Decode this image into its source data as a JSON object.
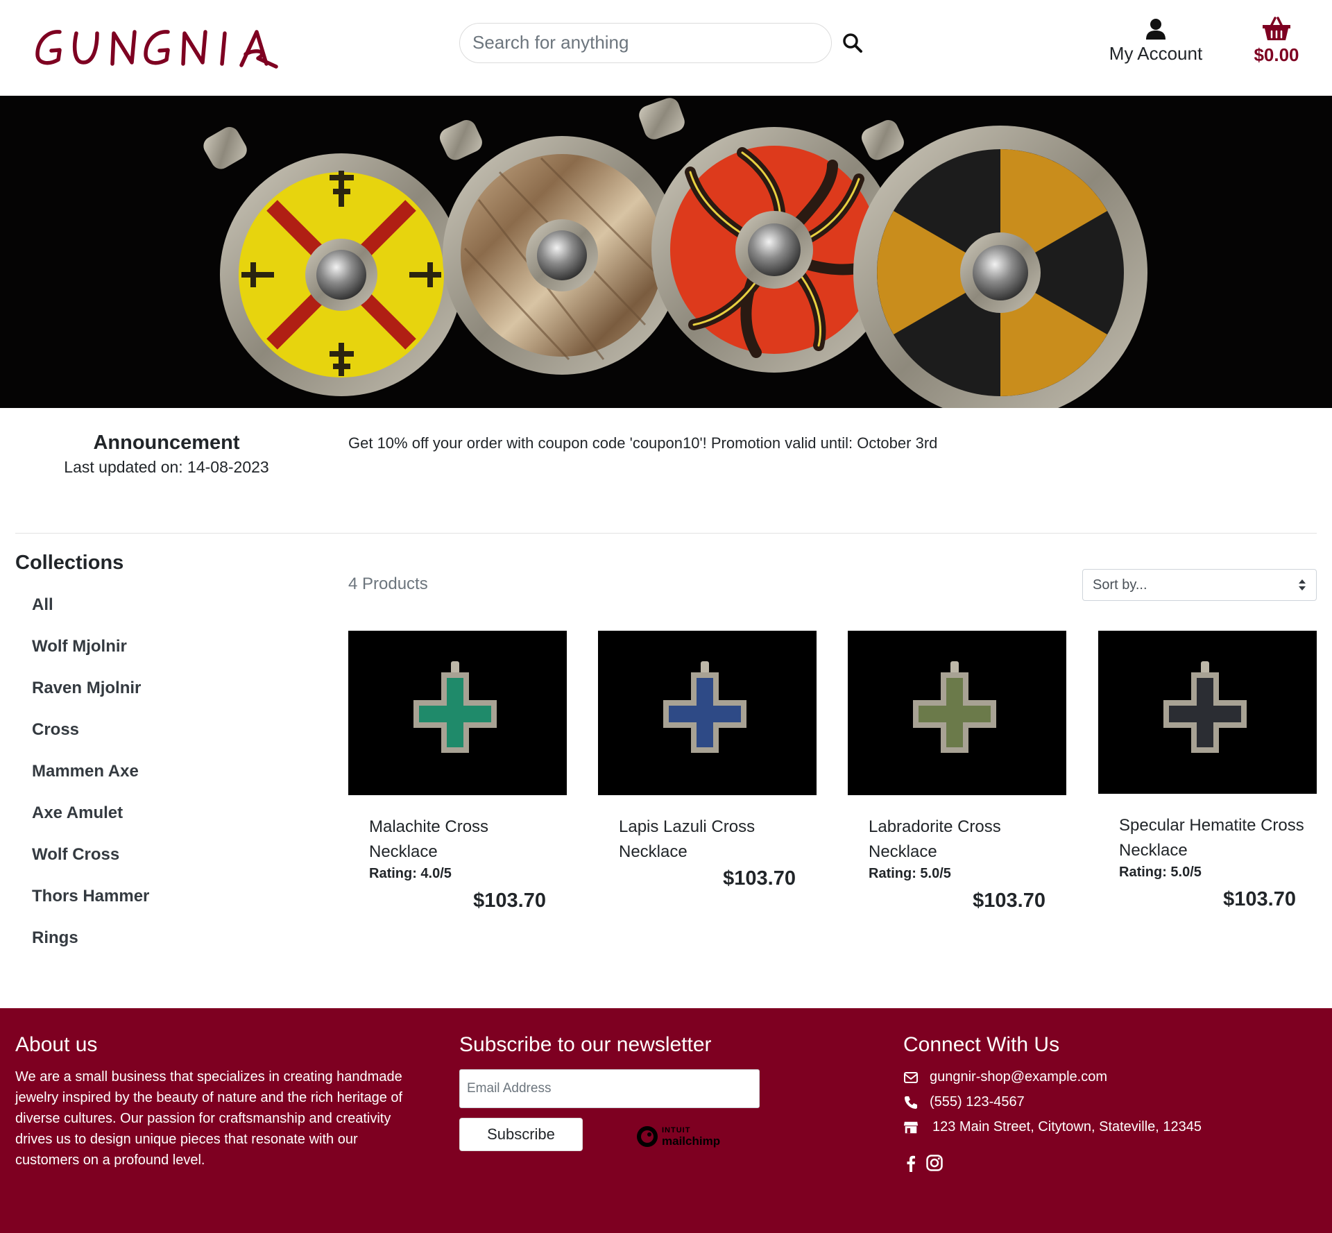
{
  "brand": {
    "logo_text": "GUNGNIR",
    "accent_color": "#7e0021"
  },
  "search": {
    "placeholder": "Search for anything"
  },
  "header": {
    "account_label": "My Account",
    "cart_total": "$0.00"
  },
  "announcement": {
    "title": "Announcement",
    "updated": "Last updated on: 14-08-2023",
    "message": "Get 10% off your order with coupon code 'coupon10'! Promotion valid until: October 3rd"
  },
  "sidebar": {
    "title": "Collections",
    "items": [
      "All",
      "Wolf Mjolnir",
      "Raven Mjolnir",
      "Cross",
      "Mammen Axe",
      "Axe Amulet",
      "Wolf Cross",
      "Thors Hammer",
      "Rings"
    ]
  },
  "products_header": {
    "count": "4 Products",
    "sort_placeholder": "Sort by..."
  },
  "products": [
    {
      "name": "Malachite Cross Necklace",
      "rating": "Rating: 4.0/5",
      "price": "$103.70",
      "stone_color": "#1f8a6a"
    },
    {
      "name": "Lapis Lazuli Cross Necklace",
      "rating": "",
      "price": "$103.70",
      "stone_color": "#2e4a86"
    },
    {
      "name": "Labradorite Cross Necklace",
      "rating": "Rating: 5.0/5",
      "price": "$103.70",
      "stone_color": "#6b7a4a"
    },
    {
      "name": "Specular Hematite Cross Necklace",
      "rating": "Rating: 5.0/5",
      "price": "$103.70",
      "stone_color": "#2b2d33"
    }
  ],
  "footer": {
    "about_title": "About us",
    "about_text": "We are a small business that specializes in creating handmade jewelry inspired by the beauty of nature and the rich heritage of diverse cultures. Our passion for craftsmanship and creativity drives us to design unique pieces that resonate with our customers on a profound level.",
    "newsletter_title": "Subscribe to our newsletter",
    "email_placeholder": "Email Address",
    "subscribe_label": "Subscribe",
    "mailchimp_line1": "INTUIT",
    "mailchimp_line2": "mailchimp",
    "connect_title": "Connect With Us",
    "email": "gungnir-shop@example.com",
    "phone": "(555) 123-4567",
    "address": "123 Main Street, Citytown, Stateville, 12345"
  }
}
